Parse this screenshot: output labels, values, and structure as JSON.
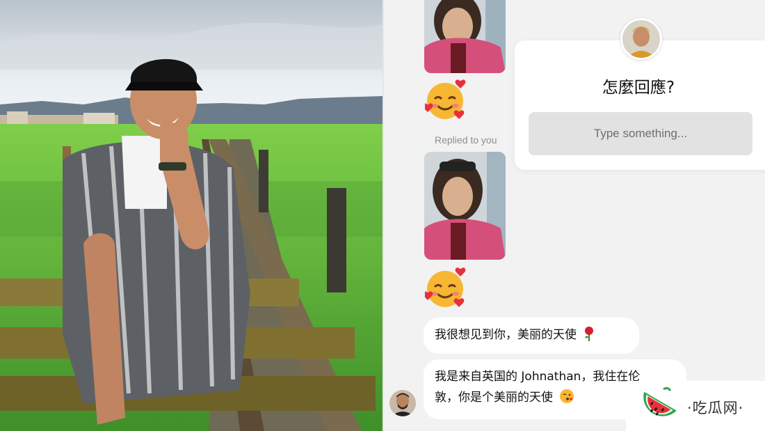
{
  "chat": {
    "replied_label": "Replied to you",
    "messages": [
      {
        "text": "我很想见到你，美丽的天使"
      },
      {
        "line1": "我是来自英国的 Johnathan，我住在伦",
        "line2": "敦，你是个美丽的天使"
      }
    ]
  },
  "reply_card": {
    "title": "怎麼回應?",
    "placeholder": "Type something..."
  },
  "watermark": {
    "text": "·吃瓜网·"
  },
  "icons": [
    "smiling-face-with-hearts-icon",
    "rose-icon",
    "kiss-face-icon",
    "watermelon-logo-icon"
  ],
  "colors": {
    "chat_bg": "#f2f2f2",
    "bubble_bg": "#ffffff",
    "input_bg": "#e2e2e2",
    "watermelon_red": "#e8303a",
    "watermelon_green": "#2ea84f"
  }
}
